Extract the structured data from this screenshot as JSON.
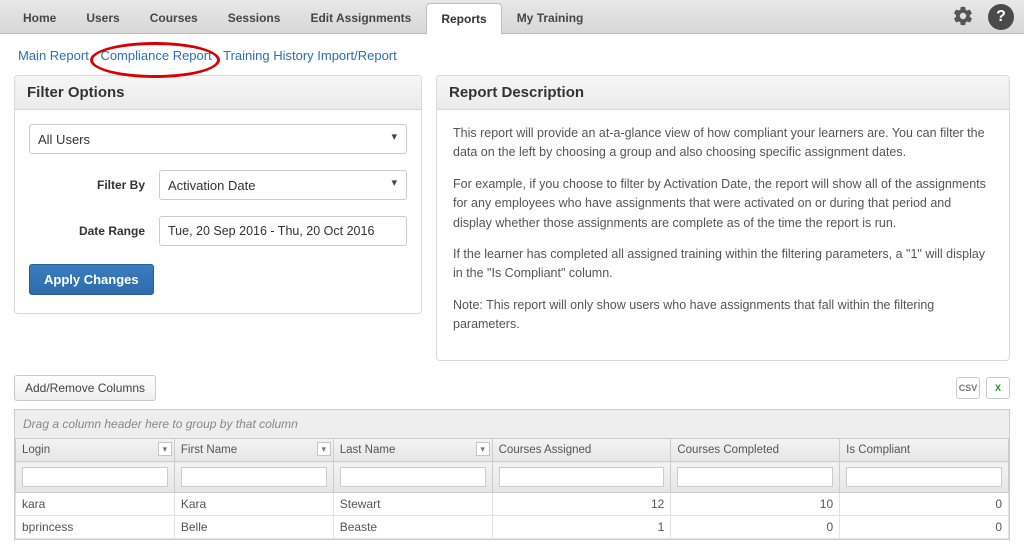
{
  "topnav": {
    "tabs": [
      "Home",
      "Users",
      "Courses",
      "Sessions",
      "Edit Assignments",
      "Reports",
      "My Training"
    ],
    "active_index": 5
  },
  "subnav": {
    "links": [
      "Main Report",
      "Compliance Report",
      "Training History Import/Report"
    ]
  },
  "filter_panel": {
    "title": "Filter Options",
    "user_select": "All Users",
    "filter_by_label": "Filter By",
    "filter_by_value": "Activation Date",
    "date_range_label": "Date Range",
    "date_range_value": "Tue, 20 Sep 2016 - Thu, 20 Oct 2016",
    "apply_button": "Apply Changes"
  },
  "desc_panel": {
    "title": "Report Description",
    "p1": "This report will provide an at-a-glance view of how compliant your learners are. You can filter the data on the left by choosing a group and also choosing specific assignment dates.",
    "p2": "For example, if you choose to filter by Activation Date, the report will show all of the assignments for any employees who have assignments that were activated on or during that period and display whether those assignments are complete as of the time the report is run.",
    "p3": "If the learner has completed all assigned training within the filtering parameters, a \"1\" will display in the \"Is Compliant\" column.",
    "p4": "Note: This report will only show users who have assignments that fall within the filtering parameters."
  },
  "grid": {
    "add_remove": "Add/Remove Columns",
    "csv_label": "CSV",
    "xls_label": "X",
    "group_tip": "Drag a column header here to group by that column",
    "columns": [
      "Login",
      "First Name",
      "Last Name",
      "Courses Assigned",
      "Courses Completed",
      "Is Compliant"
    ],
    "rows": [
      {
        "login": "kara",
        "first": "Kara",
        "last": "Stewart",
        "assigned": "12",
        "completed": "10",
        "compliant": "0"
      },
      {
        "login": "bprincess",
        "first": "Belle",
        "last": "Beaste",
        "assigned": "1",
        "completed": "0",
        "compliant": "0"
      }
    ]
  }
}
